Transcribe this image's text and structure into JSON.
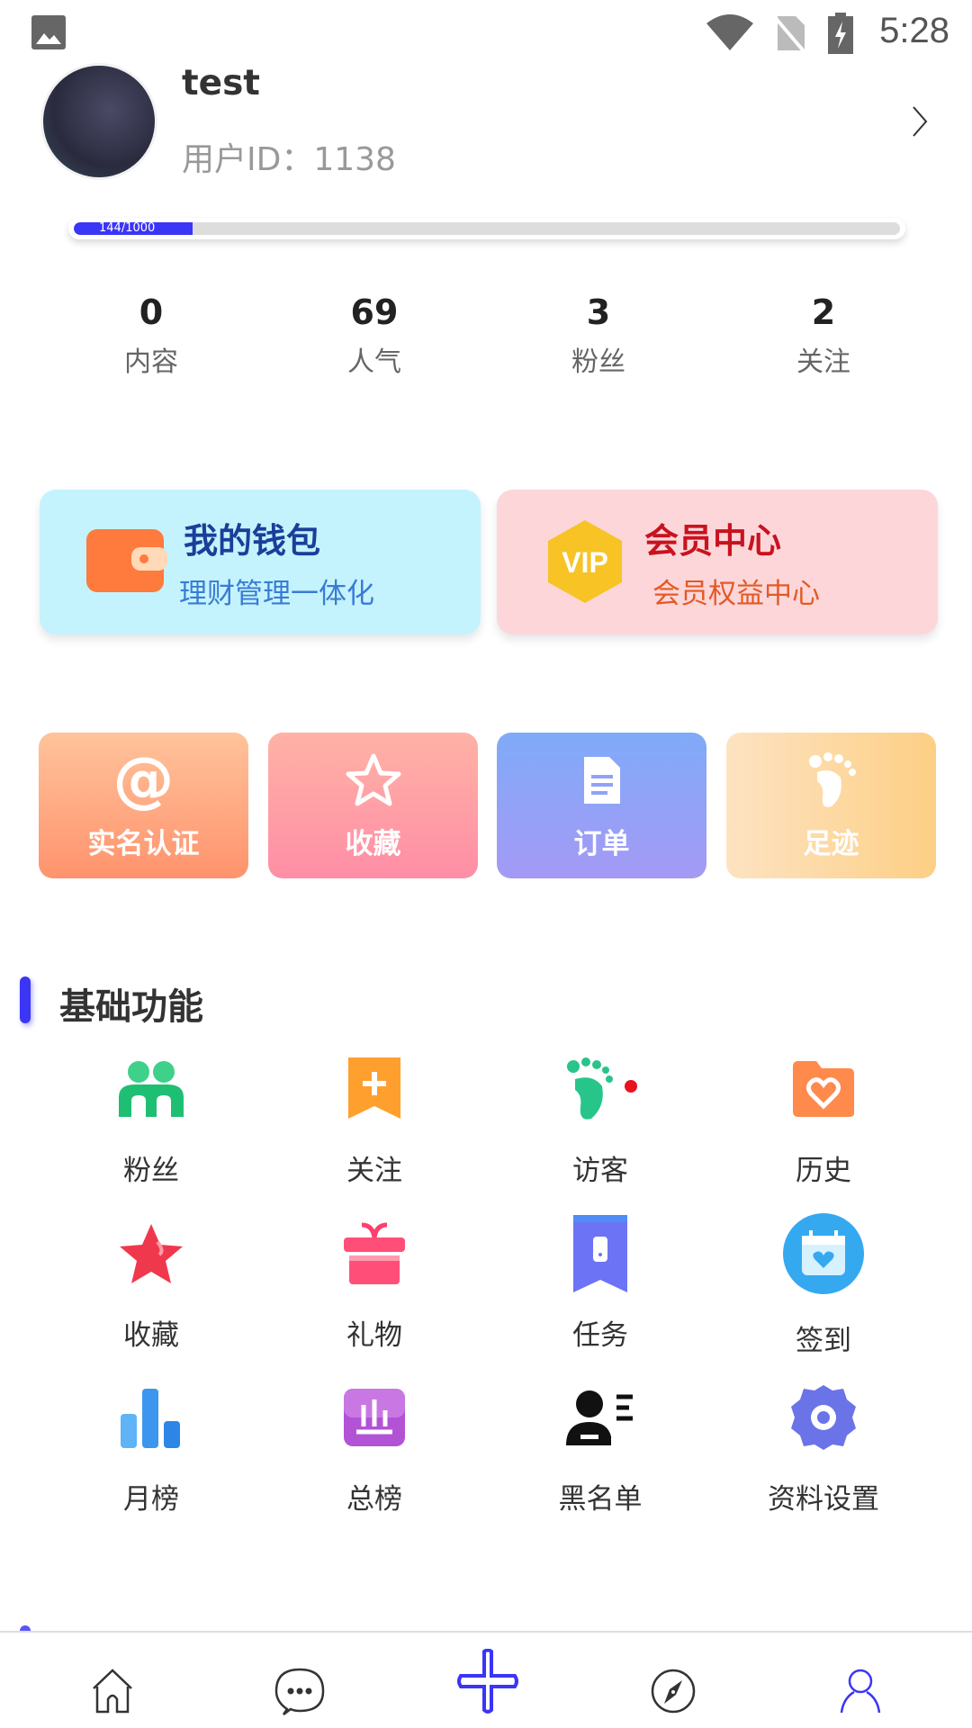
{
  "status_bar": {
    "time": "5:28",
    "icons": [
      "image-icon",
      "wifi-icon",
      "no-sim-icon",
      "battery-charging-icon"
    ]
  },
  "profile": {
    "username": "test",
    "user_id": "用户ID：1138",
    "progress_text": "144/1000",
    "progress_percent": 14.4
  },
  "stats": [
    {
      "value": "0",
      "label": "内容"
    },
    {
      "value": "69",
      "label": "人气"
    },
    {
      "value": "3",
      "label": "粉丝"
    },
    {
      "value": "2",
      "label": "关注"
    }
  ],
  "cards": {
    "wallet": {
      "title": "我的钱包",
      "subtitle": "理财管理一体化",
      "icon": "wallet-icon"
    },
    "vip": {
      "title": "会员中心",
      "subtitle": "会员权益中心",
      "icon": "vip-icon",
      "badge": "VIP"
    }
  },
  "quick": [
    {
      "label": "实名认证",
      "icon": "at-icon"
    },
    {
      "label": "收藏",
      "icon": "star-icon"
    },
    {
      "label": "订单",
      "icon": "document-icon"
    },
    {
      "label": "足迹",
      "icon": "footprint-icon"
    }
  ],
  "section": {
    "title": "基础功能"
  },
  "grid": [
    {
      "label": "粉丝",
      "icon": "fans-icon"
    },
    {
      "label": "关注",
      "icon": "follow-icon"
    },
    {
      "label": "访客",
      "icon": "visitor-icon"
    },
    {
      "label": "历史",
      "icon": "history-icon"
    },
    {
      "label": "收藏",
      "icon": "favorite-icon"
    },
    {
      "label": "礼物",
      "icon": "gift-icon"
    },
    {
      "label": "任务",
      "icon": "task-icon"
    },
    {
      "label": "签到",
      "icon": "checkin-icon"
    },
    {
      "label": "月榜",
      "icon": "monthly-rank-icon"
    },
    {
      "label": "总榜",
      "icon": "total-rank-icon"
    },
    {
      "label": "黑名单",
      "icon": "blacklist-icon"
    },
    {
      "label": "资料设置",
      "icon": "profile-settings-icon"
    }
  ],
  "bottom_nav": [
    {
      "icon": "home-icon"
    },
    {
      "icon": "message-icon"
    },
    {
      "icon": "add-icon"
    },
    {
      "icon": "discover-icon"
    },
    {
      "icon": "profile-icon",
      "active": true
    }
  ],
  "colors": {
    "accent": "#3b35f5"
  }
}
